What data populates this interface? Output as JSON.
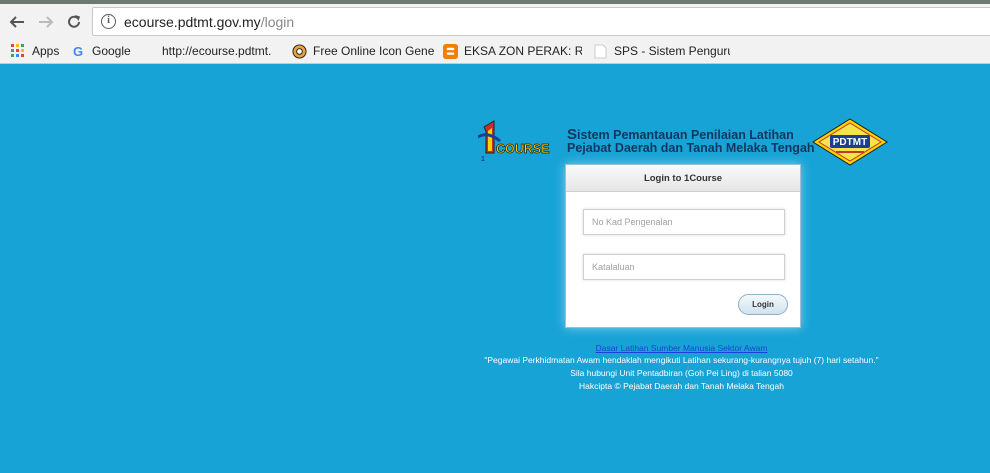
{
  "browser": {
    "url_domain": "ecourse.pdtmt.gov.my",
    "url_path": "/login",
    "bookmarks": [
      {
        "label": "Apps",
        "icon": "apps-grid-icon"
      },
      {
        "label": "Google",
        "icon": "google-icon"
      },
      {
        "label": "http://ecourse.pdtmt.",
        "icon": "none"
      },
      {
        "label": "Free Online Icon Gene",
        "icon": "lifebuoy-icon"
      },
      {
        "label": "EKSA ZON PERAK: REI",
        "icon": "blogger-icon"
      },
      {
        "label": "SPS - Sistem Penguru",
        "icon": "page-icon"
      }
    ]
  },
  "header": {
    "logo_number": "1",
    "logo_word": "COURSE",
    "line1_first": "S",
    "line1_rest": "istem Pemantauan Penilaian Latihan",
    "line2": "Pejabat Daerah dan Tanah Melaka Tengah",
    "emblem_text": "PDTMT"
  },
  "login": {
    "title": "Login to 1Course",
    "ic_placeholder": "No Kad Pengenalan",
    "ic_value": "",
    "password_placeholder": "Katalaluan",
    "password_value": "",
    "button_label": "Login"
  },
  "footer": {
    "link": "Dasar Latihan Sumber Manusia Sektor Awam",
    "quote": "\"Pegawai Perkhidmatan Awam hendaklah mengikuti Latihan sekurang-kurangnya tujuh (7) hari setahun.\"",
    "contact": "Sila hubungi Unit Pentadbiran (Goh Pei Ling) di talian 5080",
    "copyright": "Hakcipta © Pejabat Daerah dan Tanah Melaka Tengah"
  },
  "colors": {
    "page_background": "#17a3d6",
    "heading": "#12365e",
    "link": "#1f3fd8"
  }
}
